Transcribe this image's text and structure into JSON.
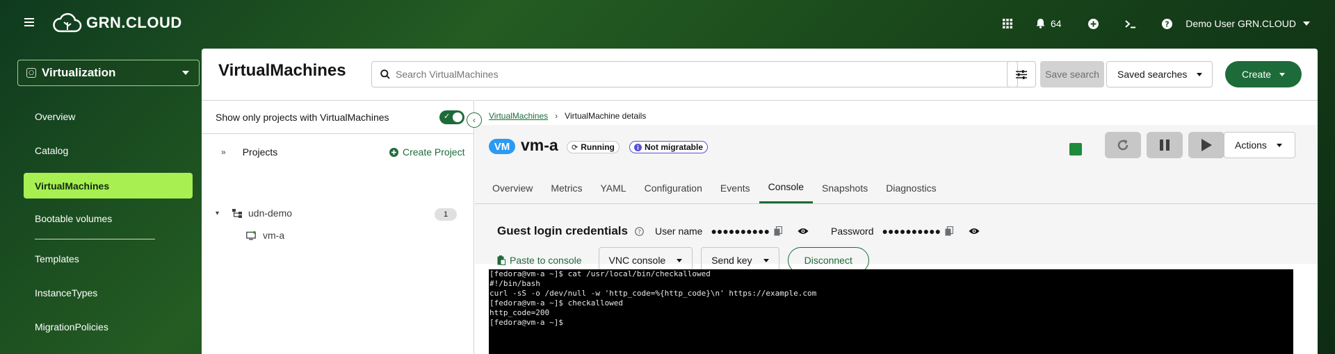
{
  "masthead": {
    "brand": "GRN.CLOUD",
    "notifications_count": "64",
    "user_name": "Demo User GRN.CLOUD"
  },
  "nav": {
    "perspective": "Virtualization",
    "items": [
      {
        "label": "Overview"
      },
      {
        "label": "Catalog"
      },
      {
        "label": "VirtualMachines",
        "active": true
      },
      {
        "label": "Bootable volumes"
      },
      {
        "label": "Templates"
      },
      {
        "label": "InstanceTypes"
      },
      {
        "label": "MigrationPolicies"
      }
    ]
  },
  "page": {
    "title": "VirtualMachines",
    "search_placeholder": "Search VirtualMachines",
    "save_search": "Save search",
    "saved_searches": "Saved searches",
    "create": "Create"
  },
  "tree": {
    "filter_label": "Show only projects with VirtualMachines",
    "filter_on": true,
    "projects_label": "Projects",
    "create_project": "Create Project",
    "project": {
      "name": "udn-demo",
      "count": "1",
      "vm": "vm-a"
    }
  },
  "detail": {
    "breadcrumb": {
      "link": "VirtualMachines",
      "current": "VirtualMachine details"
    },
    "vm_badge": "VM",
    "vm_name": "vm-a",
    "status": "Running",
    "migration": "Not migratable",
    "actions": "Actions",
    "tabs": [
      "Overview",
      "Metrics",
      "YAML",
      "Configuration",
      "Events",
      "Console",
      "Snapshots",
      "Diagnostics"
    ],
    "active_tab": "Console",
    "credentials": {
      "title": "Guest login credentials",
      "user_label": "User name",
      "user_value": "●●●●●●●●●●",
      "password_label": "Password",
      "password_value": "●●●●●●●●●●"
    },
    "console": {
      "paste": "Paste to console",
      "type": "VNC console",
      "send_key": "Send key",
      "disconnect": "Disconnect",
      "lines": [
        "[fedora@vm-a ~]$ cat /usr/local/bin/checkallowed",
        "#!/bin/bash",
        "curl -sS -o /dev/null -w 'http_code=%{http_code}\\n' https://example.com",
        "[fedora@vm-a ~]$ checkallowed",
        "http_code=200",
        "[fedora@vm-a ~]$"
      ]
    }
  },
  "colors": {
    "accent": "#1e6b3a",
    "nav_active": "#a8ef52",
    "vm_badge": "#2b9af3"
  }
}
